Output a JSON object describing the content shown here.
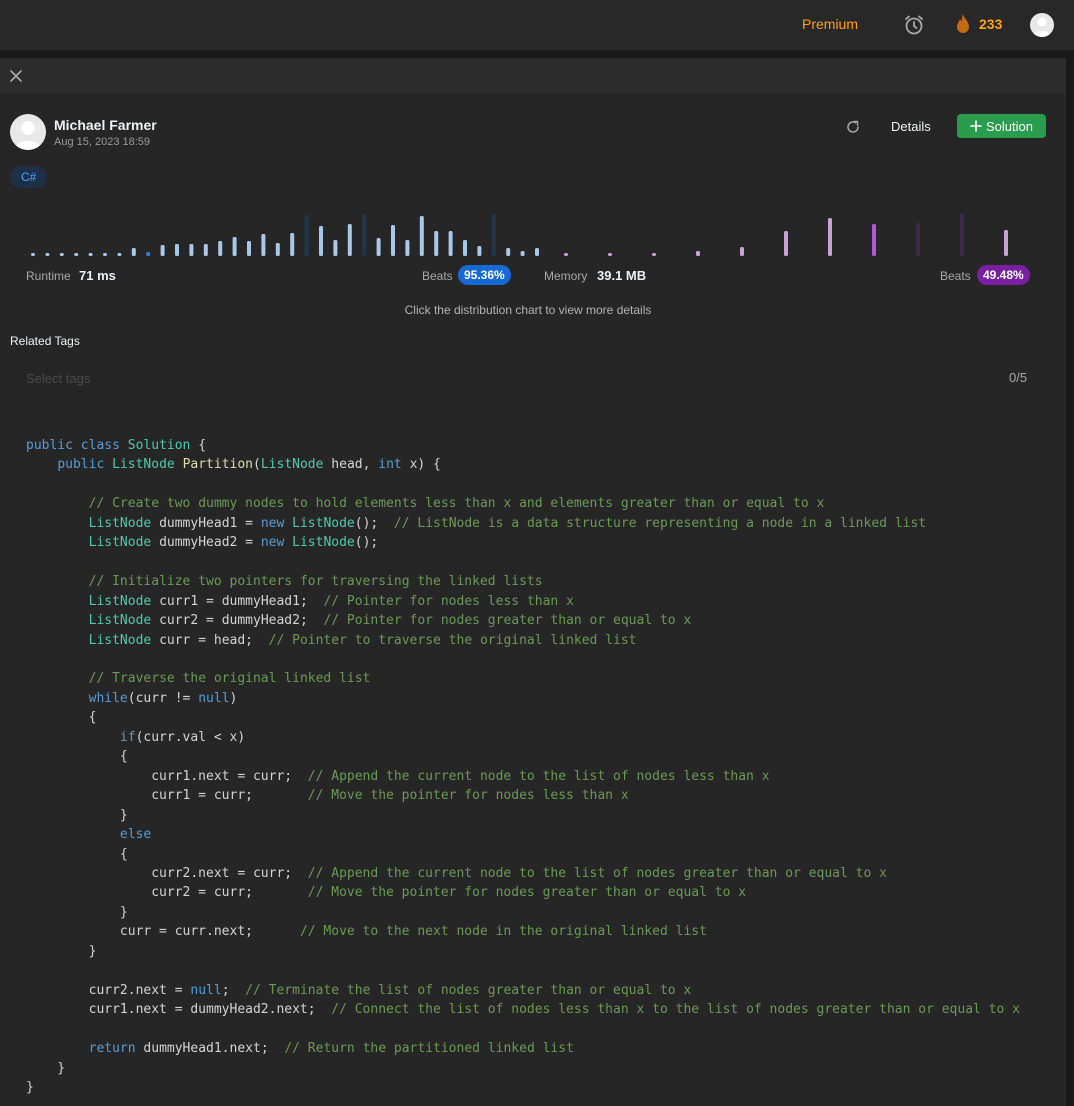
{
  "topbar": {
    "premium_label": "Premium",
    "streak_count": "233",
    "icons": [
      "timer-icon",
      "flame-icon",
      "avatar"
    ]
  },
  "submission": {
    "author": "Michael Farmer",
    "timestamp": "Aug 15, 2023 18:59",
    "details_label": "Details",
    "solution_label": "Solution",
    "language": "C#"
  },
  "stats": {
    "runtime_label": "Runtime",
    "runtime_value": "71 ms",
    "runtime_beats_label": "Beats",
    "runtime_beats": "95.36%",
    "memory_label": "Memory",
    "memory_value": "39.1 MB",
    "memory_beats_label": "Beats",
    "memory_beats": "49.48%",
    "hint": "Click the distribution chart to view more details"
  },
  "distribution": {
    "runtime_bars": [
      3,
      3,
      3,
      3,
      3,
      3,
      3,
      8,
      4,
      11,
      12,
      12,
      12,
      15,
      19,
      15,
      22,
      13,
      23,
      41,
      30,
      16,
      32,
      42,
      18,
      31,
      16,
      40,
      25,
      25,
      16,
      10,
      42,
      8,
      5,
      8
    ],
    "runtime_highlight_index": 8,
    "runtime_dark_indices": [
      19,
      23,
      32
    ],
    "memory_bars": [
      3,
      3,
      3,
      5,
      9,
      25,
      38,
      32,
      33,
      42,
      26
    ],
    "memory_highlight_index": 7,
    "memory_dark_indices": [
      8,
      9
    ]
  },
  "tags": {
    "title": "Related Tags",
    "placeholder": "Select tags",
    "count": "0/5"
  },
  "code_lines": [
    "public class Solution {",
    "    public ListNode Partition(ListNode head, int x) {",
    "",
    "        // Create two dummy nodes to hold elements less than x and elements greater than or equal to x",
    "        ListNode dummyHead1 = new ListNode();  // ListNode is a data structure representing a node in a linked list",
    "        ListNode dummyHead2 = new ListNode();",
    "",
    "        // Initialize two pointers for traversing the linked lists",
    "        ListNode curr1 = dummyHead1;  // Pointer for nodes less than x",
    "        ListNode curr2 = dummyHead2;  // Pointer for nodes greater than or equal to x",
    "        ListNode curr = head;  // Pointer to traverse the original linked list",
    "",
    "        // Traverse the original linked list",
    "        while(curr != null)",
    "        {",
    "            if(curr.val < x)",
    "            {",
    "                curr1.next = curr;  // Append the current node to the list of nodes less than x",
    "                curr1 = curr;       // Move the pointer for nodes less than x",
    "            }",
    "            else",
    "            {",
    "                curr2.next = curr;  // Append the current node to the list of nodes greater than or equal to x",
    "                curr2 = curr;       // Move the pointer for nodes greater than or equal to x",
    "            }",
    "            curr = curr.next;      // Move to the next node in the original linked list",
    "        }",
    "",
    "        curr2.next = null;  // Terminate the list of nodes greater than or equal to x",
    "        curr1.next = dummyHead2.next;  // Connect the list of nodes less than x to the list of nodes greater than or equal to x",
    "",
    "        return dummyHead1.next;  // Return the partitioned linked list",
    "    }",
    "}"
  ],
  "colors": {
    "accent_orange": "#ffa116",
    "solution_green": "#299c4d",
    "runtime_blue": "#1769d6",
    "memory_purple": "#7a1fa2"
  }
}
